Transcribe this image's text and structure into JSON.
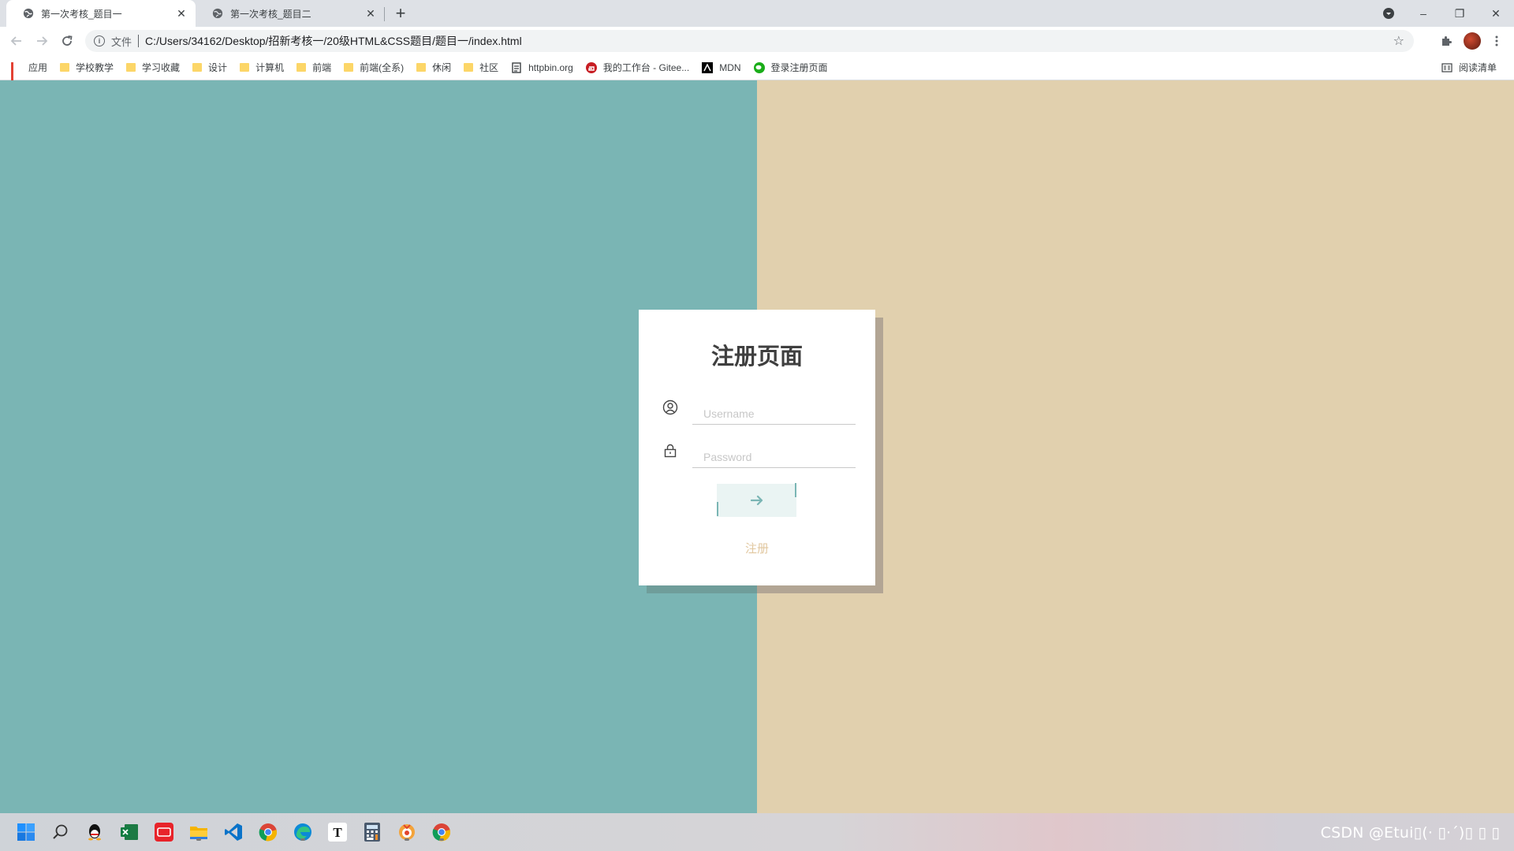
{
  "browser": {
    "tabs": [
      {
        "title": "第一次考核_题目一",
        "active": true
      },
      {
        "title": "第一次考核_题目二",
        "active": false
      }
    ],
    "new_tab": "+",
    "window_controls": {
      "minimize": "–",
      "restore": "❐",
      "close": "✕"
    },
    "address": {
      "scheme_label": "文件",
      "url": "C:/Users/34162/Desktop/招新考核一/20级HTML&CSS题目/题目一/index.html"
    },
    "bookmarks": [
      {
        "label": "应用",
        "icon": "apps-grid-icon"
      },
      {
        "label": "学校教学",
        "icon": "folder-icon"
      },
      {
        "label": "学习收藏",
        "icon": "folder-icon"
      },
      {
        "label": "设计",
        "icon": "folder-icon"
      },
      {
        "label": "计算机",
        "icon": "folder-icon"
      },
      {
        "label": "前端",
        "icon": "folder-icon"
      },
      {
        "label": "前端(全系)",
        "icon": "folder-icon"
      },
      {
        "label": "休闲",
        "icon": "folder-icon"
      },
      {
        "label": "社区",
        "icon": "folder-icon"
      },
      {
        "label": "httpbin.org",
        "icon": "page-icon"
      },
      {
        "label": "我的工作台 - Gitee...",
        "icon": "gitee-icon"
      },
      {
        "label": "MDN",
        "icon": "mdn-icon"
      },
      {
        "label": "登录注册页面",
        "icon": "wechat-icon"
      }
    ],
    "reading_list": "阅读清单"
  },
  "form": {
    "title": "注册页面",
    "username_placeholder": "Username",
    "password_placeholder": "Password",
    "submit_icon": "arrow-right-icon",
    "register_label": "注册"
  },
  "colors": {
    "left_bg": "#7ab5b4",
    "right_bg": "#e1d0ae",
    "card_bg": "#ffffff",
    "accent": "#7ab5b4",
    "link": "#e1c79f"
  },
  "taskbar": {
    "icons": [
      "windows-start-icon",
      "search-icon",
      "qq-icon",
      "excel-icon",
      "youdao-icon",
      "file-explorer-icon",
      "vscode-icon",
      "chrome-icon",
      "edge-icon",
      "typora-icon",
      "calculator-icon",
      "app-icon",
      "chrome-icon"
    ],
    "tray_text": "CSDN @Etui▯(· ▯·´)▯  ▯ ▯"
  }
}
